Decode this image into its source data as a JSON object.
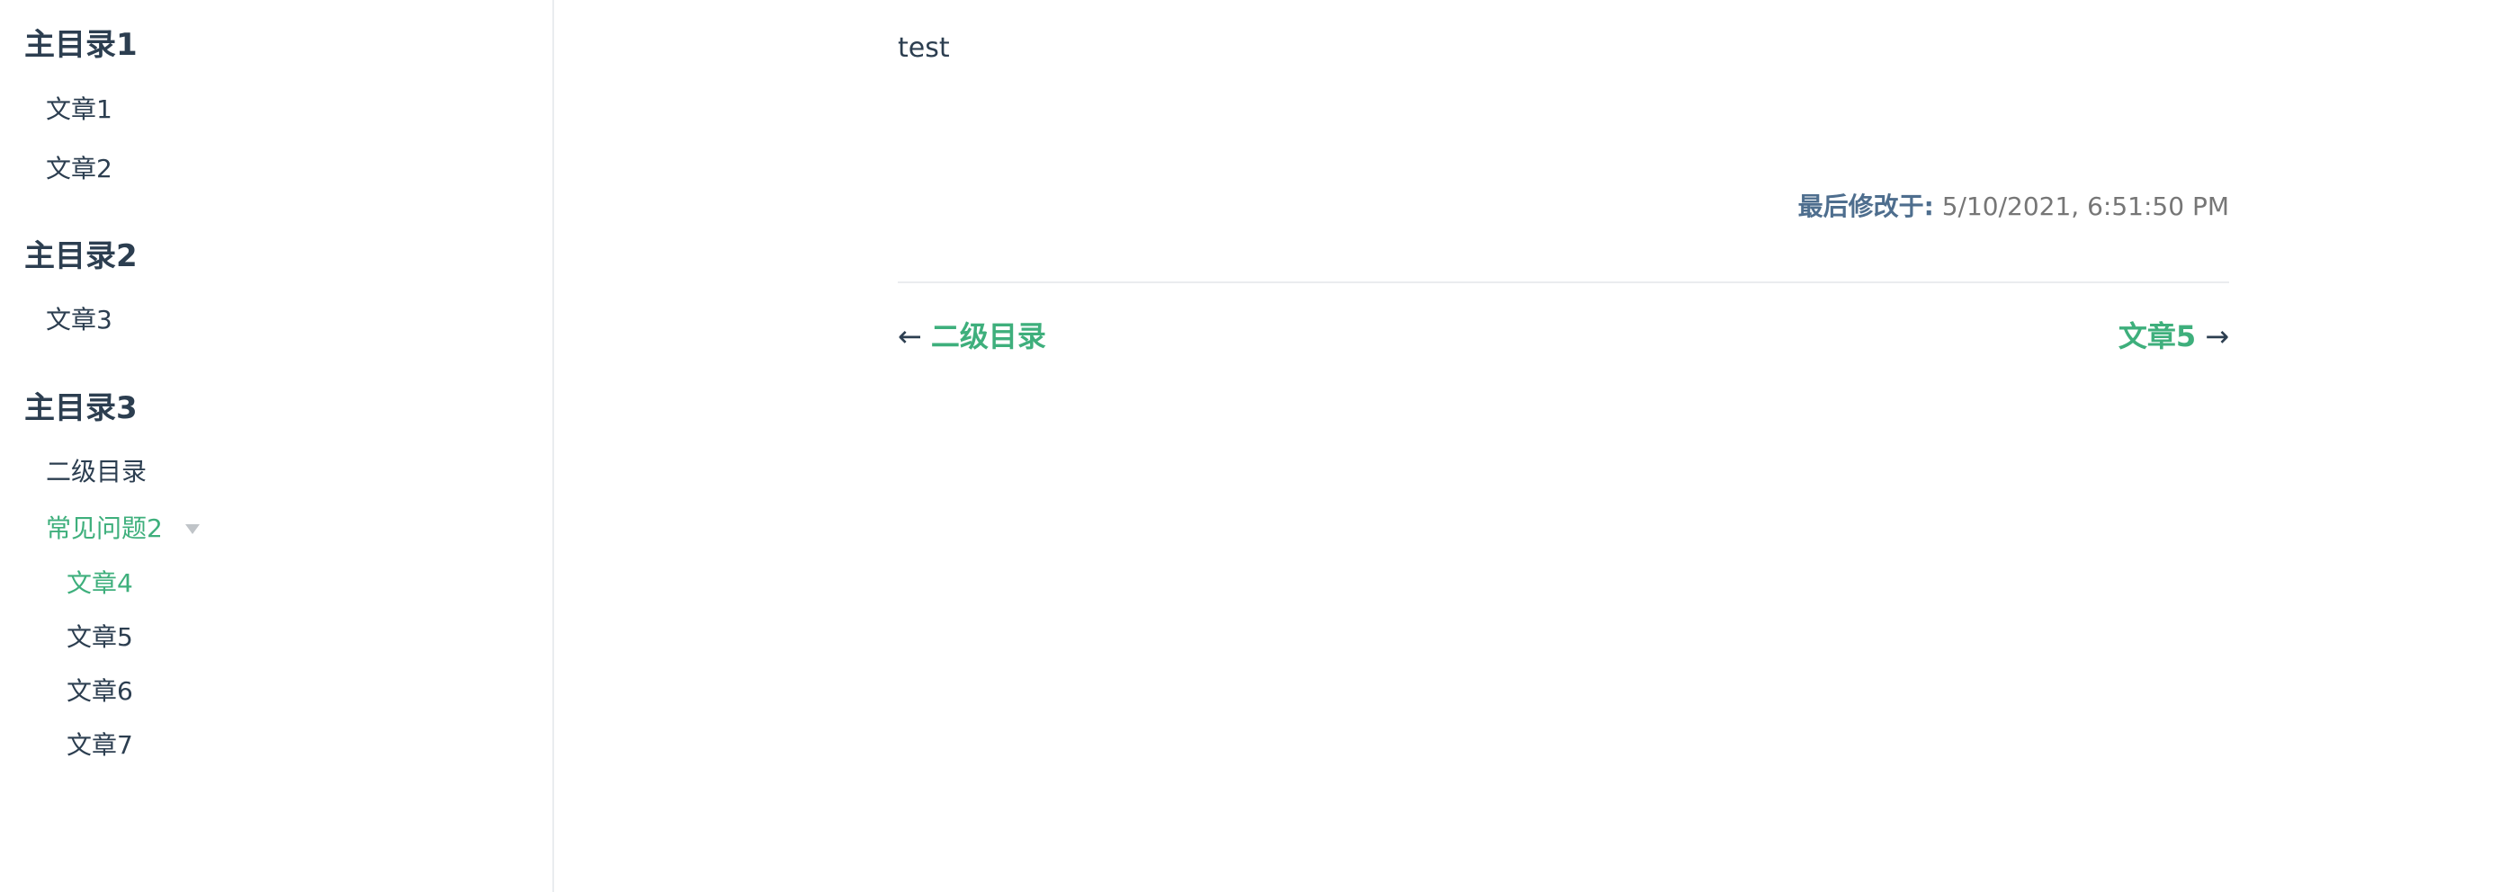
{
  "sidebar": {
    "groups": [
      {
        "title": "主目录1",
        "items": [
          "文章1",
          "文章2"
        ]
      },
      {
        "title": "主目录2",
        "items": [
          "文章3"
        ]
      },
      {
        "title": "主目录3",
        "items": [
          "二级目录"
        ],
        "subgroup": {
          "title": "常见问题2",
          "items": [
            "文章4",
            "文章5",
            "文章6",
            "文章7"
          ]
        }
      }
    ],
    "active_item": "文章4"
  },
  "content": {
    "text": "test",
    "last_updated_prefix": "最后修改于:",
    "last_updated_value": "5/10/2021, 6:51:50 PM"
  },
  "pager": {
    "prev_arrow": "←",
    "prev_label": "二级目录",
    "next_label": "文章5",
    "next_arrow": "→"
  },
  "colors": {
    "accent": "#3eaf7c",
    "text": "#2c3e50",
    "border": "#eaecef"
  }
}
